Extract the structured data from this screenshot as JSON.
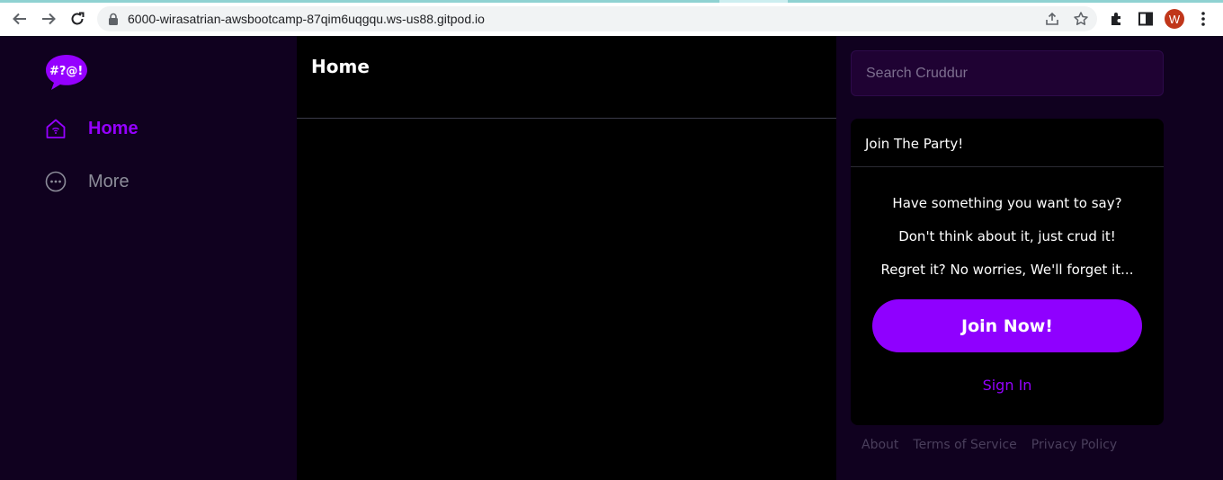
{
  "browser": {
    "url": "6000-wirasatrian-awsbootcamp-87qim6uqgqu.ws-us88.gitpod.io",
    "avatar_letter": "W"
  },
  "sidebar": {
    "logo_text": "#?@!",
    "items": [
      {
        "label": "Home",
        "icon": "home-icon"
      },
      {
        "label": "More",
        "icon": "more-icon"
      }
    ]
  },
  "feed": {
    "title": "Home"
  },
  "search": {
    "placeholder": "Search Cruddur"
  },
  "join": {
    "title": "Join The Party!",
    "lines": [
      "Have something you want to say?",
      "Don't think about it, just crud it!",
      "Regret it? No worries, We'll forget it..."
    ],
    "button": "Join Now!",
    "signin": "Sign In"
  },
  "footer": {
    "links": [
      "About",
      "Terms of Service",
      "Privacy Policy"
    ]
  },
  "colors": {
    "accent": "#9500ff",
    "background": "#10011f",
    "feed_background": "#000000"
  }
}
